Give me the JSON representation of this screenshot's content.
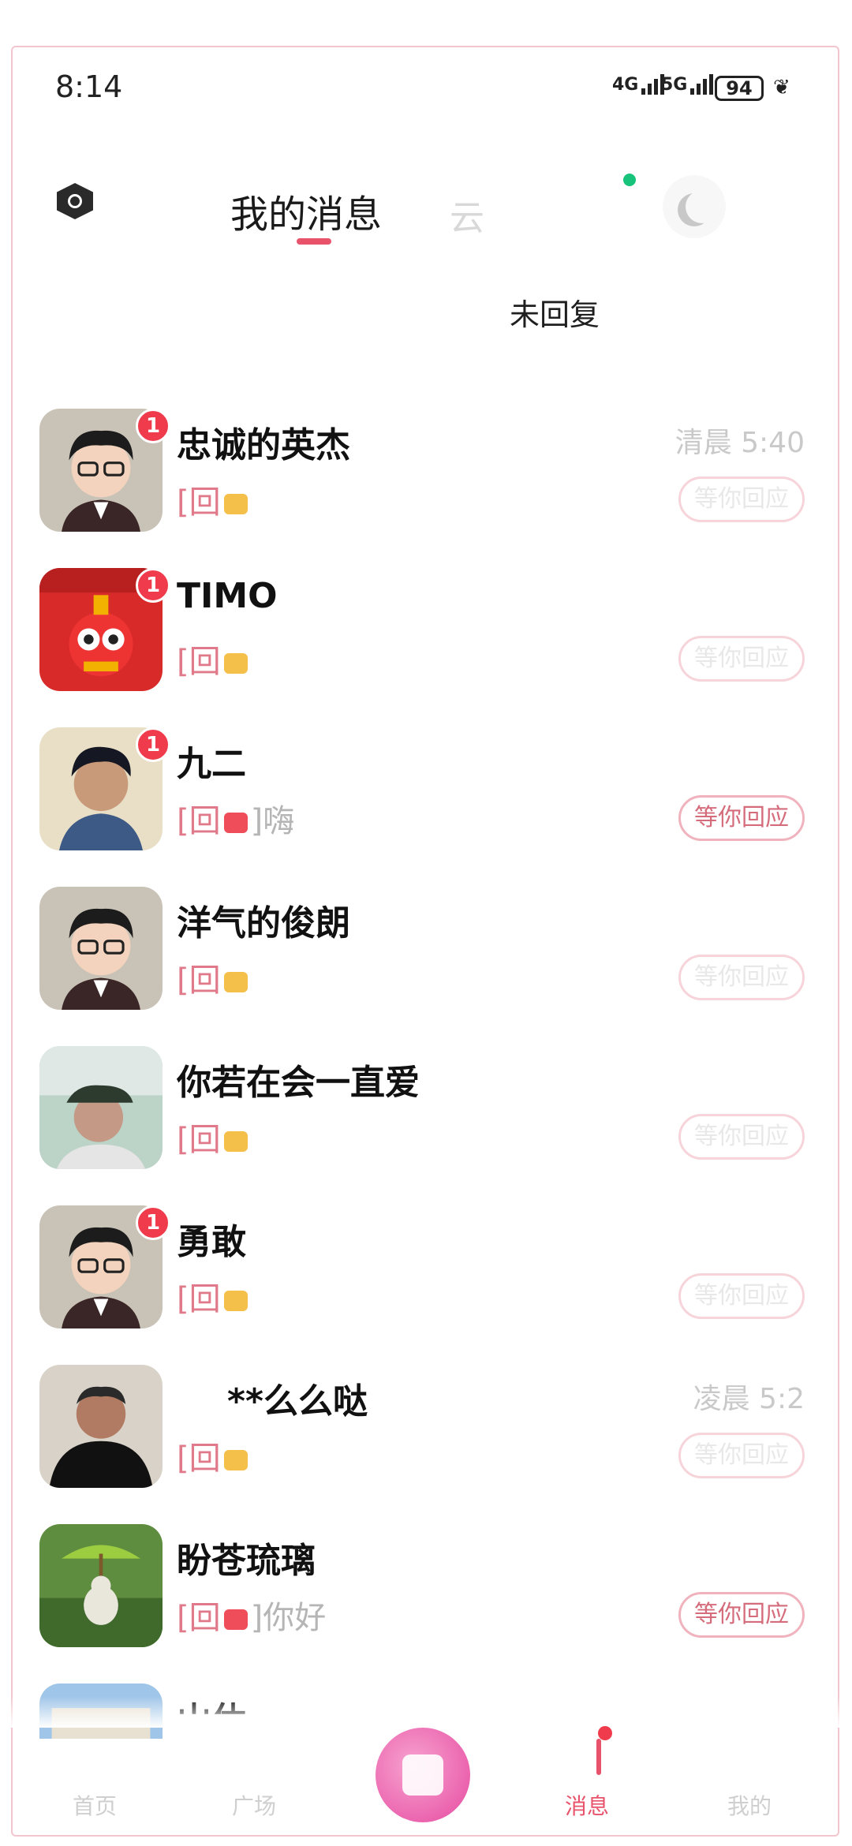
{
  "status_bar": {
    "time": "8:14",
    "net1": "4G",
    "net2": "5G",
    "battery": "94"
  },
  "header": {
    "tab_title": "我的消息",
    "tab_ghost": "云",
    "subheading": "未回复"
  },
  "colors": {
    "accent": "#e8536b",
    "badge": "#ef3b4c",
    "online": "#17c37b"
  },
  "messages": [
    {
      "name": "忠诚的英杰",
      "badge": "1",
      "preview_prefix": "[回",
      "preview_rest": "",
      "time": "清晨 5:40",
      "reply_label": "等你回应",
      "avatar": "cartoon-man-avatar"
    },
    {
      "name": "TIMO",
      "badge": "1",
      "preview_prefix": "[回",
      "preview_rest": "",
      "time": "",
      "reply_label": "等你回应",
      "avatar": "robot-avatar"
    },
    {
      "name": "九二",
      "badge": "1",
      "preview_prefix": "[回",
      "preview_rest": "]嗨",
      "time": "",
      "reply_label": "等你回应",
      "avatar": "young-man-photo"
    },
    {
      "name": "洋气的俊朗",
      "badge": "",
      "preview_prefix": "[回",
      "preview_rest": "",
      "time": "",
      "reply_label": "等你回应",
      "avatar": "cartoon-man-avatar"
    },
    {
      "name": "你若在会一直爱",
      "badge": "",
      "preview_prefix": "[回",
      "preview_rest": "",
      "time": "",
      "reply_label": "等你回应",
      "avatar": "older-man-photo"
    },
    {
      "name": "勇敢",
      "badge": "1",
      "preview_prefix": "[回",
      "preview_rest": "",
      "time": "",
      "reply_label": "等你回应",
      "avatar": "cartoon-man-avatar"
    },
    {
      "name": "**么么哒",
      "badge": "",
      "preview_prefix": "[回",
      "preview_rest": "",
      "time": "凌晨 5:2",
      "reply_label": "等你回应",
      "avatar": "man-black-jacket-photo"
    },
    {
      "name": "盼苍琉璃",
      "badge": "",
      "preview_prefix": "[回",
      "preview_rest": "]你好",
      "time": "",
      "reply_label": "等你回应",
      "avatar": "bird-umbrella-photo"
    },
    {
      "name": "山休",
      "badge": "",
      "preview_prefix": "",
      "preview_rest": "",
      "time": "",
      "reply_label": "",
      "avatar": "building-photo"
    }
  ],
  "bottom_nav": {
    "home": "首页",
    "square": "广场",
    "messages": "消息",
    "me": "我的"
  }
}
